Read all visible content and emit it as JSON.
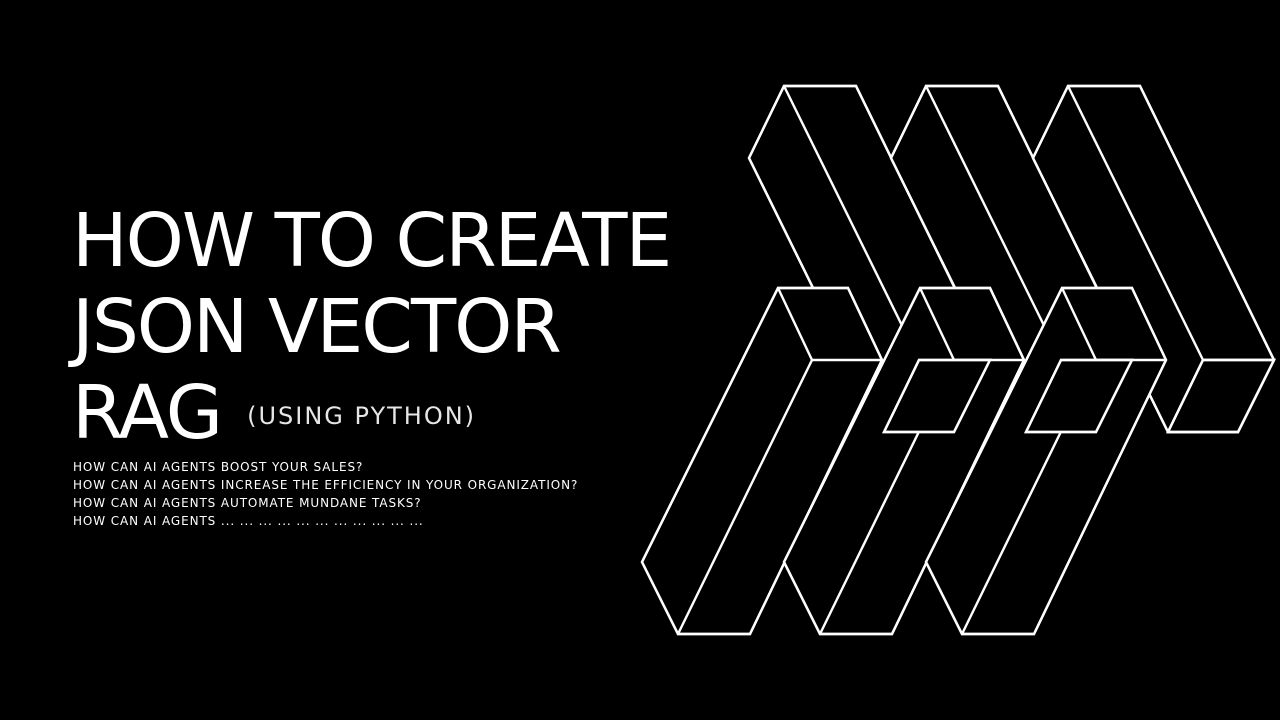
{
  "slide": {
    "title_lines": [
      "HOW TO CREATE",
      "JSON VECTOR",
      "RAG"
    ],
    "subtitle": "(USING PYTHON)",
    "questions": [
      "HOW CAN AI AGENTS BOOST YOUR SALES?",
      "HOW CAN AI AGENTS INCREASE THE EFFICIENCY IN YOUR ORGANIZATION?",
      "HOW CAN AI AGENTS AUTOMATE MUNDANE TASKS?",
      "HOW CAN AI AGENTS ... ... ... ... ... ... ... ... ... ... ..."
    ]
  },
  "colors": {
    "background": "#000000",
    "foreground": "#ffffff"
  },
  "artwork": {
    "name": "isometric-bars-graphic",
    "bar_count": 6
  }
}
